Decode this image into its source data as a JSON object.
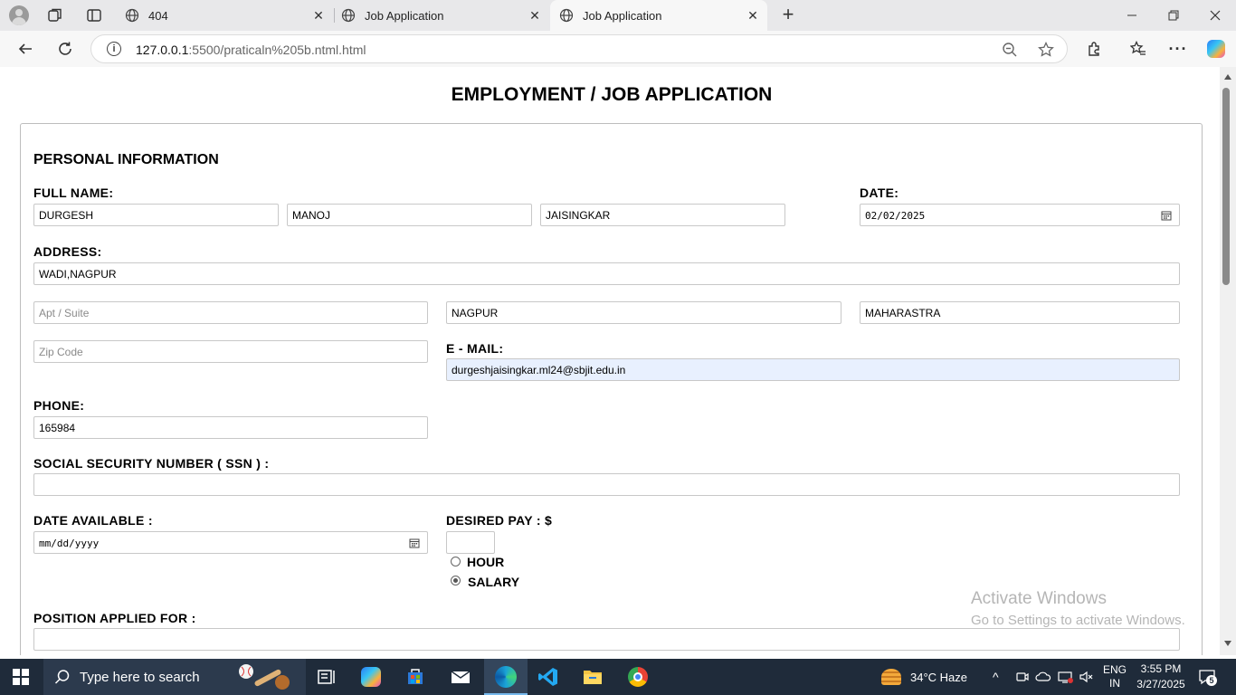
{
  "browser": {
    "tabs": [
      {
        "title": "404",
        "active": false
      },
      {
        "title": "Job Application",
        "active": false
      },
      {
        "title": "Job Application",
        "active": true
      }
    ],
    "url_host": "127.0.0.1",
    "url_rest": ":5500/praticaln%205b.ntml.html"
  },
  "form": {
    "title": "EMPLOYMENT / JOB APPLICATION",
    "section_personal": "PERSONAL INFORMATION",
    "full_name_label": "FULL NAME:",
    "first_name": "DURGESH",
    "middle_name": "MANOJ",
    "last_name": "JAISINGKAR",
    "date_label": "DATE:",
    "date_value": "02/02/2025",
    "address_label": "ADDRESS:",
    "address_value": "WADI,NAGPUR",
    "apt_placeholder": "Apt / Suite",
    "city_value": "NAGPUR",
    "state_value": "MAHARASTRA",
    "zip_placeholder": "Zip Code",
    "email_label": "E - MAIL:",
    "email_value": "durgeshjaisingkar.ml24@sbjit.edu.in",
    "phone_label": "PHONE:",
    "phone_value": "165984",
    "ssn_label": "SOCIAL SECURITY NUMBER ( SSN ) :",
    "ssn_value": "",
    "date_available_label": "DATE AVAILABLE :",
    "date_available_placeholder": "mm/dd/yyyy",
    "desired_pay_label": "DESIRED PAY : $",
    "pay_value": "",
    "pay_options": [
      {
        "label": "HOUR",
        "checked": false
      },
      {
        "label": "SALARY",
        "checked": true
      }
    ],
    "position_label": "POSITION APPLIED FOR :",
    "position_value": ""
  },
  "watermark": {
    "line1": "Activate Windows",
    "line2": "Go to Settings to activate Windows."
  },
  "taskbar": {
    "search_placeholder": "Type here to search",
    "weather": "34°C  Haze",
    "lang1": "ENG",
    "lang2": "IN",
    "time": "3:55 PM",
    "date": "3/27/2025",
    "notifications": "5"
  }
}
